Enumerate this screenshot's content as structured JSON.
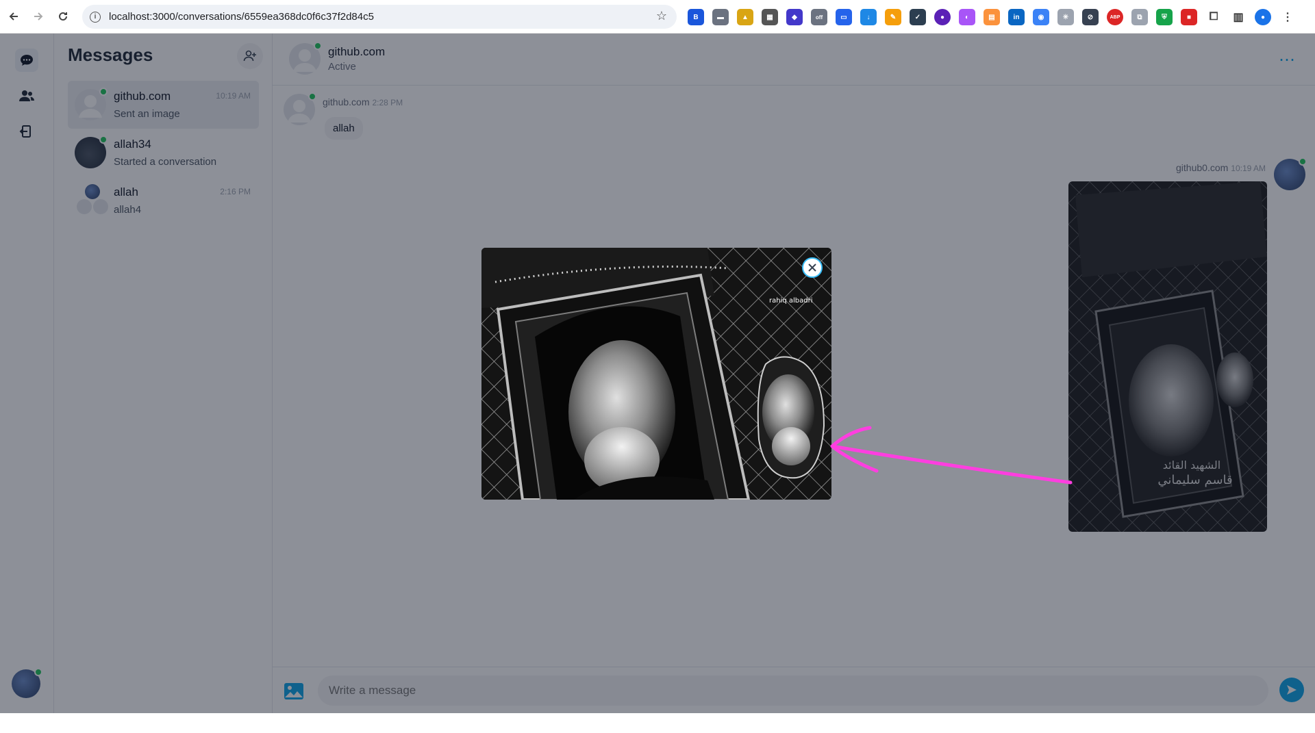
{
  "browser": {
    "url": "localhost:3000/conversations/6559ea368dc0f6c37f2d84c5",
    "badge": "off",
    "abp": "ABP"
  },
  "sidebar": {
    "title": "Messages"
  },
  "conversations": [
    {
      "name": "github.com",
      "preview": "Sent an image",
      "time": "10:19 AM"
    },
    {
      "name": "allah34",
      "preview": "Started a conversation",
      "time": ""
    },
    {
      "name": "allah",
      "preview": "allah4",
      "time": "2:16 PM"
    }
  ],
  "chat": {
    "name": "github.com",
    "status": "Active",
    "more": "⋯",
    "messages": [
      {
        "sender": "github.com",
        "time": "2:28 PM",
        "text": "allah"
      },
      {
        "sender": "github0.com",
        "time": "10:19 AM"
      }
    ],
    "composer_placeholder": "Write a message"
  },
  "modal_image": {
    "watermark": "rahiq  albadri"
  },
  "poster": {
    "line1": "الشهيد القائد",
    "line2": "قاسم سليماني"
  },
  "colors": {
    "accent": "#0ea5e9",
    "online": "#22c55e",
    "annotation_arrow": "#ff3ee0"
  }
}
